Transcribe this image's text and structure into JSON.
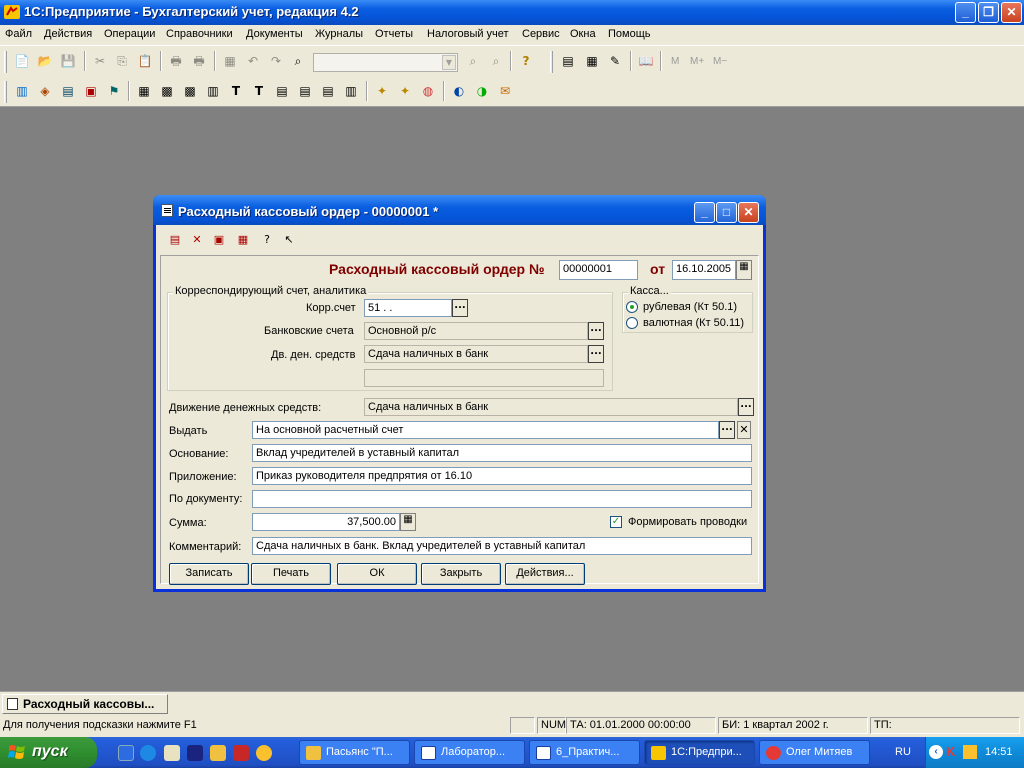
{
  "app": {
    "title": "1С:Предприятие - Бухгалтерский учет, редакция 4.2"
  },
  "menu": [
    "Файл",
    "Действия",
    "Операции",
    "Справочники",
    "Документы",
    "Журналы",
    "Отчеты",
    "Налоговый учет",
    "Сервис",
    "Окна",
    "Помощь"
  ],
  "toolbar": {
    "calc_labels": [
      "M",
      "M+",
      "M−"
    ]
  },
  "dialog": {
    "title": "Расходный кассовый ордер - 00000001 *",
    "heading": "Расходный кассовый ордер №",
    "number": "00000001",
    "date_label": "от",
    "date": "16.10.2005",
    "corr_group_title": "Корреспондирующий счет, аналитика",
    "korr_label": "Корр.счет",
    "korr_value": "51 .  .",
    "bank_label": "Банковские счета",
    "bank_value": "Основной р/с",
    "dds_label": "Дв. ден. средств",
    "dds_value": "Сдача наличных в банк",
    "extra_value": "",
    "kassa_title": "Касса...",
    "kassa_rub": "рублевая (Кт 50.1)",
    "kassa_val": "валютная (Кт 50.11)",
    "movement_label": "Движение денежных средств:",
    "movement_value": "Сдача наличных в банк",
    "vydat_label": "Выдать",
    "vydat_value": "На основной расчетный счет",
    "osnovanie_label": "Основание:",
    "osnovanie_value": "Вклад учредителей в уставный капитал",
    "prilozhenie_label": "Приложение:",
    "prilozhenie_value": "Приказ руководителя предпрятия от 16.10",
    "po_doc_label": "По документу:",
    "po_doc_value": "",
    "summa_label": "Сумма:",
    "summa_value": "37,500.00",
    "form_label": "Формировать проводки",
    "comment_label": "Комментарий:",
    "comment_value": "Сдача наличных в банк. Вклад учредителей в уставный капитал",
    "buttons": {
      "save": "Записать",
      "print": "Печать",
      "ok": "ОК",
      "close": "Закрыть",
      "actions": "Действия..."
    }
  },
  "window_tab": "Расходный кассовы...",
  "status": {
    "hint": "Для получения подсказки нажмите F1",
    "num": "NUM",
    "ta": "ТА: 01.01.2000  00:00:00",
    "bi": "БИ: 1 квартал 2002 г.",
    "tp": "ТП:"
  },
  "taskbar": {
    "start": "пуск",
    "tasks": [
      "Пасьянс \"П...",
      "Лаборатор...",
      "6_Практич...",
      "1С:Предпри...",
      "Олег Митяев"
    ],
    "lang": "RU",
    "clock": "14:51"
  }
}
